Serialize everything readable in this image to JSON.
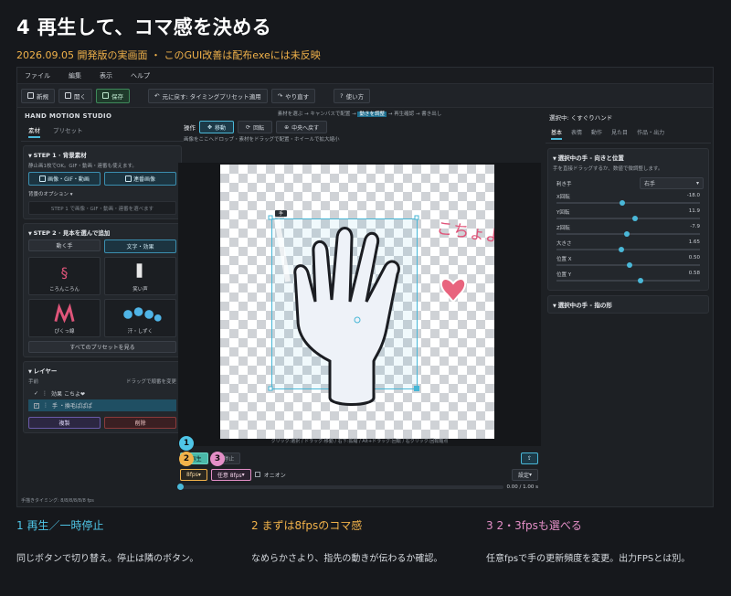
{
  "heading": {
    "title": "4  再生して、コマ感を決める",
    "subtitle": "2026.09.05 開発版の実画面 ・ このGUI改善は配布exeには未反映"
  },
  "menu": [
    "ファイル",
    "編集",
    "表示",
    "ヘルプ"
  ],
  "toolbar": {
    "new": "新規",
    "open": "開く",
    "save": "保存",
    "undo": "元に戻す: タイミングプリセット適用",
    "redo": "やり直す",
    "help": "使い方"
  },
  "left": {
    "studio": "HAND MOTION STUDIO",
    "tabs": [
      "素材",
      "プリセット"
    ],
    "step1": {
      "title": "STEP 1 · 背景素材",
      "desc": "静止画1枚でOK。GIF・動画・連番も使えます。",
      "btn_image": "画像・GIF・動画",
      "btn_seq": "連番画像",
      "options": "背景のオプション",
      "hint": "STEP 1 で画像・GIF・動画・連番を選べます"
    },
    "step2": {
      "title": "STEP 2 · 見本を選んで追加",
      "tab_hand": "動く手",
      "tab_text": "文字・効果",
      "stickers": [
        "ころんころん",
        "笑い声",
        "ぴくっ線",
        "汗・しずく"
      ],
      "all": "すべてのプリセットを見る"
    },
    "layers": {
      "title": "レイヤー",
      "col_name": "手前",
      "col_hint": "ドラッグで順番を変更",
      "rows": [
        "効果  こちよ❤",
        "手  ・換毛ぱぱぱ"
      ],
      "dup": "複製",
      "del": "削除"
    }
  },
  "center": {
    "flow": [
      "素材を選ぶ",
      "キャンバスで配置",
      "動きを調整",
      "再生確認",
      "書き出し"
    ],
    "flow_active": "動きを調整",
    "ops_label": "操作",
    "ops": [
      "移動",
      "回転",
      "中央へ戻す"
    ],
    "drop_tip": "画像をここへドロップ・素材をドラッグで配置・ホイールで拡大縮小",
    "canvas_foot": "クリック:選択 / ドラッグ:移動 / 右下:拡縮 / Alt+ドラッグ:回転 / 右クリック:回転軸点",
    "hand_tag": "手",
    "sticker_text": "こちょよ",
    "play": "再生",
    "stop": "停止",
    "fps": "8fps",
    "sub_fps": "任意 8fps",
    "onion": "オニオン",
    "settings": "設定",
    "time": "0.00 / 1.00 s",
    "progress": 0.0
  },
  "right": {
    "title": "選択中: くすぐりハンド",
    "tabs": [
      "基本",
      "表情",
      "動作",
      "見た目",
      "作品・出力"
    ],
    "section": "選択中の手 - 向きと位置",
    "desc": "手を直接ドラッグするか、数値で微調整します。",
    "hand_label": "利き手",
    "hand_value": "右手",
    "sliders": [
      {
        "name": "X回転",
        "value": "-18.0",
        "level": 0.45
      },
      {
        "name": "Y回転",
        "value": "11.9",
        "level": 0.54
      },
      {
        "name": "Z回転",
        "value": "-7.9",
        "level": 0.48
      },
      {
        "name": "大きさ",
        "value": "1.65",
        "level": 0.44
      },
      {
        "name": "位置 X",
        "value": "0.50",
        "level": 0.5
      },
      {
        "name": "位置 Y",
        "value": "0.58",
        "level": 0.58
      }
    ],
    "section2": "選択中の手 - 指の形"
  },
  "statusbar": "手描きタイミング: 8/8/8/8/8/8 fps",
  "badges": [
    "1",
    "2",
    "3"
  ],
  "captions": [
    {
      "num": "1",
      "title": "再生／一時停止",
      "text": "同じボタンで切り替え。停止は隣のボタン。",
      "color": "#4fc6e8"
    },
    {
      "num": "2",
      "title": "まずは8fpsのコマ感",
      "text": "なめらかさより、指先の動きが伝わるか確認。",
      "color": "#f1b24a"
    },
    {
      "num": "3",
      "title": "2・3fpsも選べる",
      "text": "任意fpsで手の更新頻度を変更。出力FPSとは別。",
      "color": "#e48fc7"
    }
  ]
}
